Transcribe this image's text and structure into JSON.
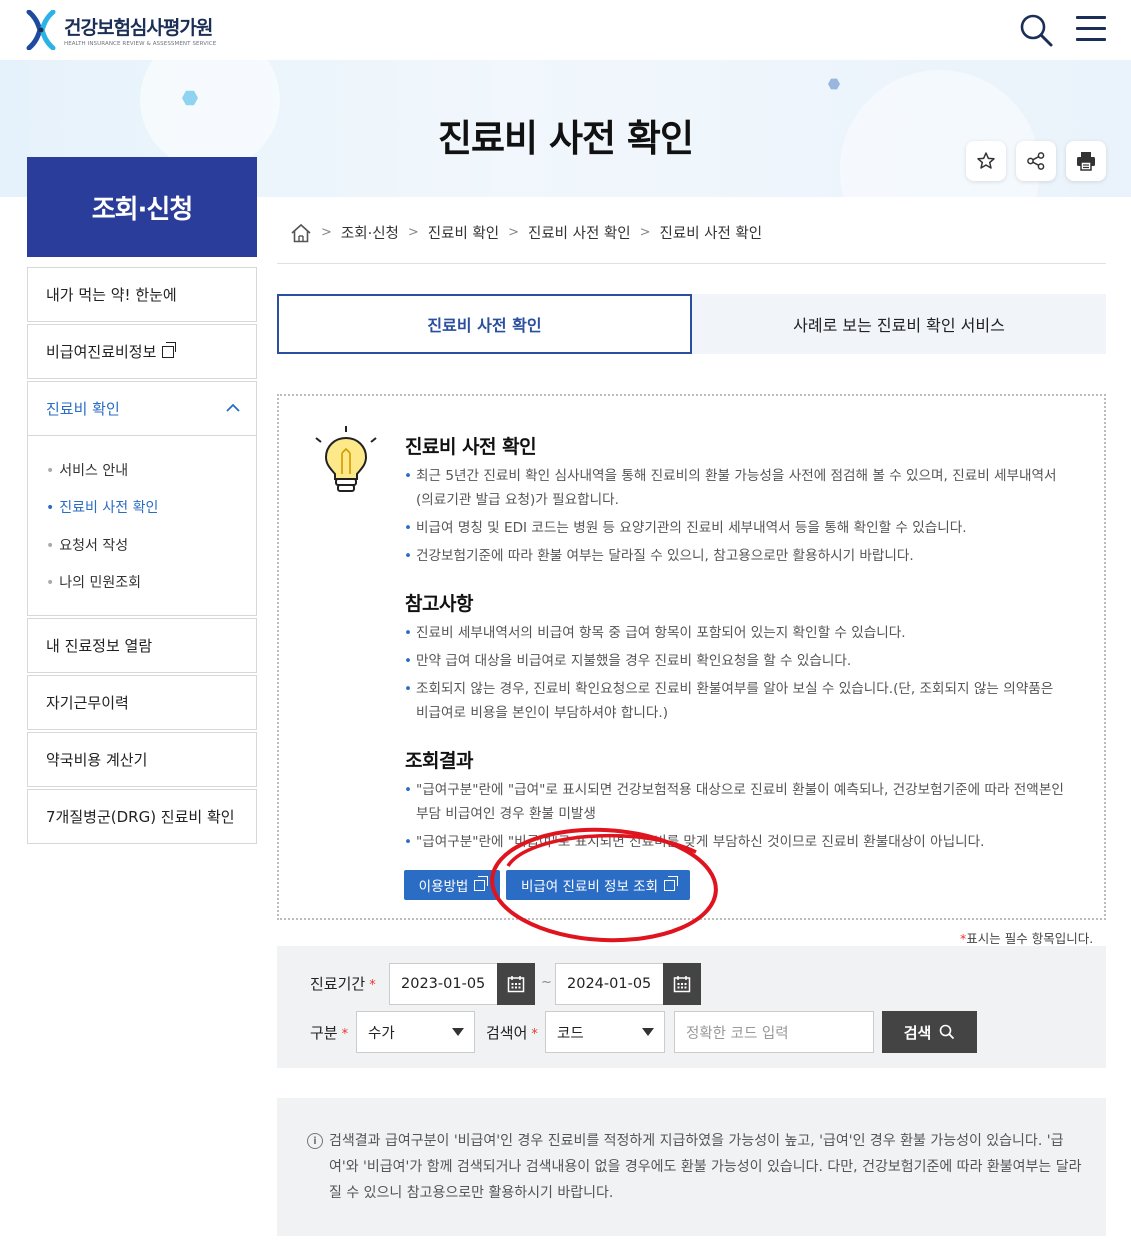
{
  "header": {
    "logo_title": "건강보험심사평가원",
    "logo_sub": "HEALTH INSURANCE REVIEW & ASSESSMENT SERVICE",
    "search_icon": "search-icon",
    "menu_icon": "hamburger-menu-icon"
  },
  "banner": {
    "title": "진료비 사전 확인",
    "utils": [
      "star-icon",
      "share-icon",
      "print-icon"
    ]
  },
  "sidebar": {
    "title": "조회·신청",
    "items": [
      {
        "label": "내가 먹는 약! 한눈에"
      },
      {
        "label": "비급여진료비정보"
      },
      {
        "label": "진료비 확인"
      },
      {
        "label": "내 진료정보 열람"
      },
      {
        "label": "자기근무이력"
      },
      {
        "label": "약국비용 계산기"
      },
      {
        "label": "7개질병군(DRG) 진료비 확인"
      }
    ],
    "sub_items": [
      {
        "label": "서비스 안내"
      },
      {
        "label": "진료비 사전 확인"
      },
      {
        "label": "요청서 작성"
      },
      {
        "label": "나의 민원조회"
      }
    ]
  },
  "breadcrumb": [
    "조회·신청",
    "진료비 확인",
    "진료비 사전 확인",
    "진료비 사전 확인"
  ],
  "tabs": {
    "active": "진료비 사전 확인",
    "other": "사례로 보는 진료비 확인 서비스"
  },
  "info": {
    "sec1_title": "진료비 사전 확인",
    "sec1_b1": "최근 5년간 진료비 확인 심사내역을 통해 진료비의 환불 가능성을 사전에 점검해 볼 수 있으며, 진료비 세부내역서(의료기관 발급 요청)가 필요합니다.",
    "sec1_b2": "비급여 명칭 및 EDI 코드는 병원 등 요양기관의 진료비 세부내역서 등을 통해 확인할 수 있습니다.",
    "sec1_b3": "건강보험기준에 따라 환불 여부는 달라질 수 있으니, 참고용으로만 활용하시기 바랍니다.",
    "sec2_title": "참고사항",
    "sec2_b1": "진료비 세부내역서의 비급여 항목 중 급여 항목이 포함되어 있는지 확인할 수 있습니다.",
    "sec2_b2": "만약 급여 대상을 비급여로 지불했을 경우 진료비 확인요청을 할 수 있습니다.",
    "sec2_b3": "조회되지 않는 경우, 진료비 확인요청으로 진료비 환불여부를 알아 보실 수 있습니다.(단, 조회되지 않는 의약품은 비급여로 비용을 본인이 부담하셔야 합니다.)",
    "sec3_title": "조회결과",
    "sec3_b1": "\"급여구분\"란에 \"급여\"로 표시되면 건강보험적용 대상으로 진료비 환불이 예측되나, 건강보험기준에 따라 전액본인부담 비급여인 경우 환불 미발생",
    "sec3_b2": "\"급여구분\"란에 \"비급여\"로 표시되면 진료비를 맞게 부담하신 것이므로 진료비 환불대상이 아닙니다.",
    "btn_howto": "이용방법",
    "btn_noncovered": "비급여 진료비 정보 조회"
  },
  "form": {
    "required_note": "표시는 필수 항목입니다.",
    "period_label": "진료기간",
    "date_from": "2023-01-05",
    "date_to": "2024-01-05",
    "tilde": "~",
    "type_label": "구분",
    "type_value": "수가",
    "keyword_label": "검색어",
    "keyword_type": "코드",
    "keyword_placeholder": "정확한 코드 입력",
    "search_label": "검색"
  },
  "notice": {
    "text": "검색결과 급여구분이 '비급여'인 경우 진료비를 적정하게 지급하였을 가능성이 높고, '급여'인 경우 환불 가능성이 있습니다. '급여'와 '비급여'가 함께 검색되거나 검색내용이 없을 경우에도 환불 가능성이 있습니다. 다만, 건강보험기준에 따라 환불여부는 달라질 수 있으니 참고용으로만 활용하시기 바랍니다."
  },
  "colors": {
    "primary": "#2a3d9a",
    "accent_blue": "#2b6cc4",
    "annotation_red": "#e0141e"
  }
}
